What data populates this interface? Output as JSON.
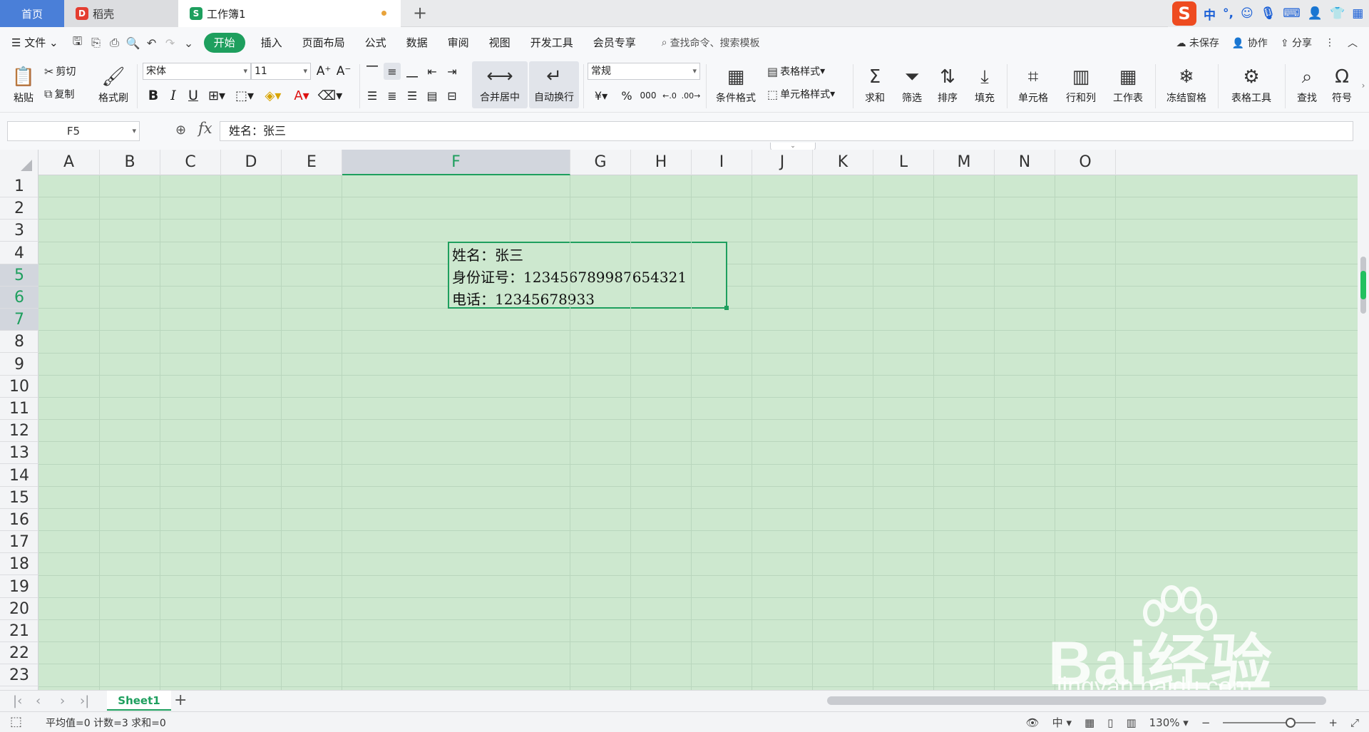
{
  "tabs": {
    "home": "首页",
    "daoke": "稻壳",
    "workbook": "工作簿1",
    "colors": {
      "home_bg": "#4a7fd8",
      "daoke_logo": "#e43d30",
      "wps_logo": "#1e9f5e"
    }
  },
  "ime": {
    "logo": "S",
    "mode": "中"
  },
  "menu": {
    "file": "文件",
    "items": [
      "开始",
      "插入",
      "页面布局",
      "公式",
      "数据",
      "审阅",
      "视图",
      "开发工具",
      "会员专享"
    ],
    "search_placeholder": "查找命令、搜索模板",
    "unsaved": "未保存",
    "collab": "协作",
    "share": "分享"
  },
  "ribbon": {
    "paste": "粘贴",
    "cut": "剪切",
    "copy": "复制",
    "format_painter": "格式刷",
    "font_name": "宋体",
    "font_size": "11",
    "merge_center": "合并居中",
    "wrap_text": "自动换行",
    "number_format": "常规",
    "cond_format": "条件格式",
    "table_style": "表格样式",
    "cell_style": "单元格样式",
    "sum": "求和",
    "filter": "筛选",
    "sort": "排序",
    "fill": "填充",
    "cell": "单元格",
    "row_col": "行和列",
    "worksheet": "工作表",
    "freeze": "冻结窗格",
    "table_tools": "表格工具",
    "find": "查找",
    "symbol": "符号"
  },
  "formula_bar": {
    "cell_ref": "F5",
    "fx": "fx",
    "content": "姓名：张三"
  },
  "grid": {
    "columns": [
      "A",
      "B",
      "C",
      "D",
      "E",
      "F",
      "G",
      "H",
      "I",
      "J",
      "K",
      "L",
      "M",
      "N",
      "O"
    ],
    "rows": [
      "1",
      "2",
      "3",
      "4",
      "5",
      "6",
      "7",
      "8",
      "9",
      "10",
      "11",
      "12",
      "13",
      "14",
      "15",
      "16",
      "17",
      "18",
      "19",
      "20",
      "21",
      "22",
      "23"
    ],
    "active_column": "F",
    "active_rows": [
      "5",
      "6",
      "7"
    ],
    "cell_F5_lines": [
      "姓名：张三",
      "身份证号：123456789987654321",
      "电话：12345678933"
    ],
    "bg_color": "#cde8cf",
    "selection_color": "#1e9f5e"
  },
  "sheets": {
    "active": "Sheet1"
  },
  "status": {
    "summary": "平均值=0 计数=3 求和=0",
    "ime": "中",
    "zoom": "130%"
  },
  "watermark": {
    "brand": "Bai经验",
    "url": "jingyan.baidu.com"
  }
}
